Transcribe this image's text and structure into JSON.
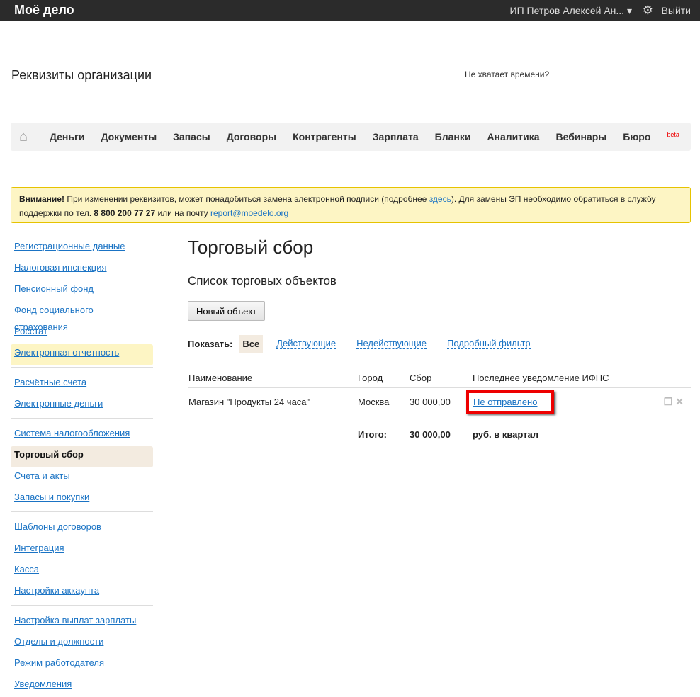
{
  "topbar": {
    "logo": "Моё дело",
    "user": "ИП Петров Алексей Ан...",
    "logout": "Выйти"
  },
  "header": {
    "title": "Реквизиты организации",
    "no_time": "Не хватает времени?"
  },
  "nav": {
    "items": [
      "Деньги",
      "Документы",
      "Запасы",
      "Договоры",
      "Контрагенты",
      "Зарплата",
      "Бланки",
      "Аналитика",
      "Вебинары",
      "Бюро"
    ],
    "beta": "beta"
  },
  "warning": {
    "bold": "Внимание!",
    "text1": " При изменении реквизитов, может понадобиться замена электронной подписи (подробнее ",
    "link": "здесь",
    "text2": "). Для замены ЭП необходимо обратиться в службу поддержки по тел. ",
    "phone": "8 800 200 77 27",
    "text3": " или на почту ",
    "email": "report@moedelo.org"
  },
  "sidebar": {
    "groups": [
      [
        "Регистрационные данные",
        "Налоговая инспекция",
        "Пенсионный фонд",
        "Фонд социального страхования",
        "Росстат",
        "Электронная отчетность"
      ],
      [
        "Расчётные счета",
        "Электронные деньги"
      ],
      [
        "Система налогообложения",
        "Торговый сбор",
        "Счета и акты",
        "Запасы и покупки"
      ],
      [
        "Шаблоны договоров",
        "Интеграция",
        "Касса",
        "Настройки аккаунта"
      ],
      [
        "Настройка выплат зарплаты",
        "Отделы и должности",
        "Режим работодателя",
        "Уведомления"
      ]
    ]
  },
  "main": {
    "title": "Торговый сбор",
    "subtitle": "Список торговых объектов",
    "new_button": "Новый объект",
    "filter": {
      "label": "Показать:",
      "all": "Все",
      "active": "Действующие",
      "inactive": "Недействующие",
      "detailed": "Подробный фильтр"
    },
    "table": {
      "headers": [
        "Наименование",
        "Город",
        "Сбор",
        "Последнее уведомление ИФНС"
      ],
      "rows": [
        {
          "name": "Магазин \"Продукты 24 часа\"",
          "city": "Москва",
          "fee": "30 000,00",
          "status": "Не отправлено"
        }
      ],
      "total_label": "Итого:",
      "total": "30 000,00",
      "total_unit": "руб. в квартал"
    }
  }
}
